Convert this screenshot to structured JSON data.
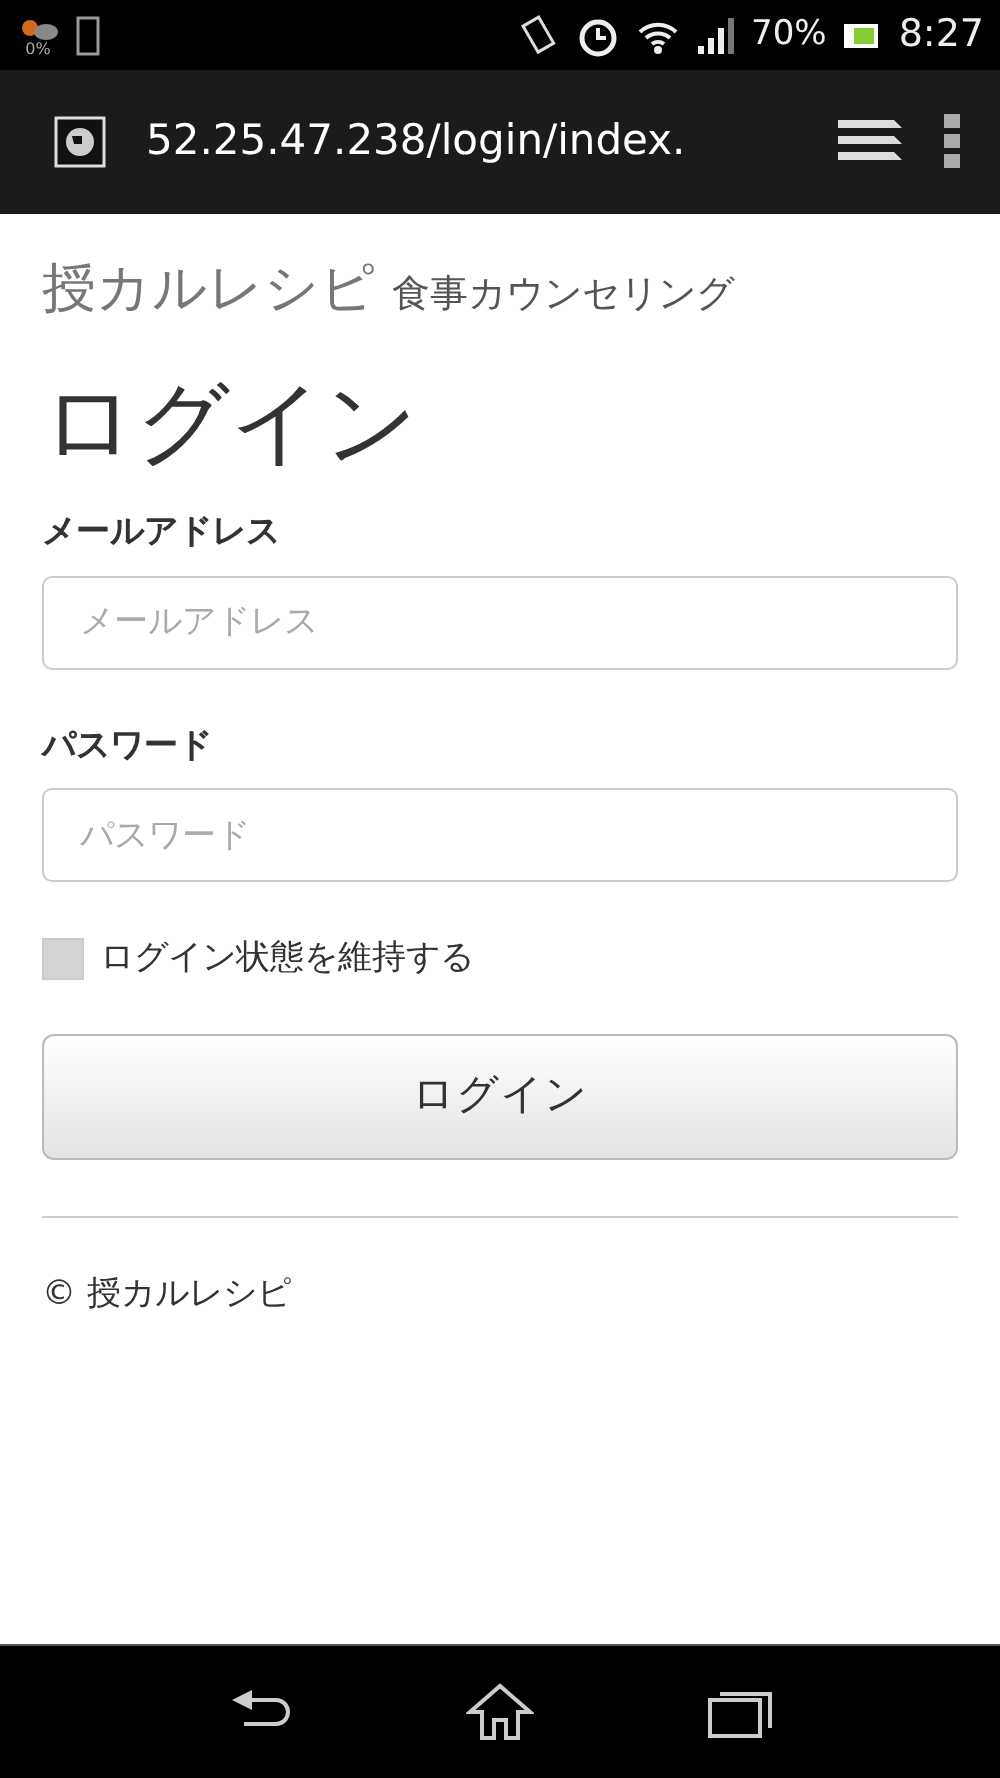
{
  "status_bar": {
    "weather_reading": "0%",
    "battery": "70%",
    "time": "8:27"
  },
  "browser": {
    "url": "52.25.47.238/login/index."
  },
  "page": {
    "brand": "授カルレシピ",
    "tagline": "食事カウンセリング",
    "heading": "ログイン",
    "fields": [
      {
        "label": "メールアドレス",
        "placeholder": "メールアドレス"
      },
      {
        "label": "パスワード",
        "placeholder": "パスワード"
      }
    ],
    "remember": {
      "label": "ログイン状態を維持する",
      "checked": false
    },
    "submit": "ログイン",
    "footer": "© 授カルレシピ"
  }
}
